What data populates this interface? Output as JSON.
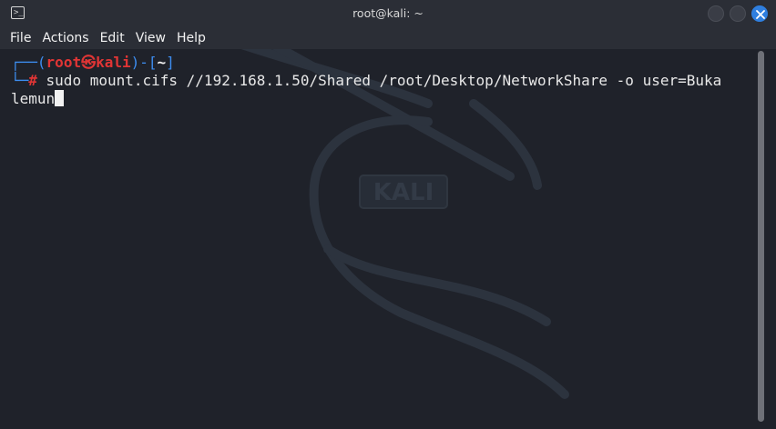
{
  "window": {
    "title": "root@kali: ~",
    "app_icon_glyph": ">_"
  },
  "menu": {
    "items": [
      "File",
      "Actions",
      "Edit",
      "View",
      "Help"
    ]
  },
  "terminal": {
    "prompt_corner_top": "┌──",
    "prompt_open": "(",
    "prompt_user": "root",
    "prompt_at_symbol": "㉿",
    "prompt_host": "kali",
    "prompt_mid": ")-[",
    "prompt_dir": "~",
    "prompt_close": "]",
    "prompt_corner_bottom": "└─",
    "prompt_symbol": "#",
    "command_line_1": " sudo mount.cifs //192.168.1.50/Shared /root/Desktop/NetworkShare -o user=Buka",
    "command_line_2": "lemun",
    "watermark_text": "KALI"
  },
  "colors": {
    "prompt_blue": "#3d8df0",
    "prompt_red": "#e03535",
    "close_button": "#2f7fe0"
  }
}
